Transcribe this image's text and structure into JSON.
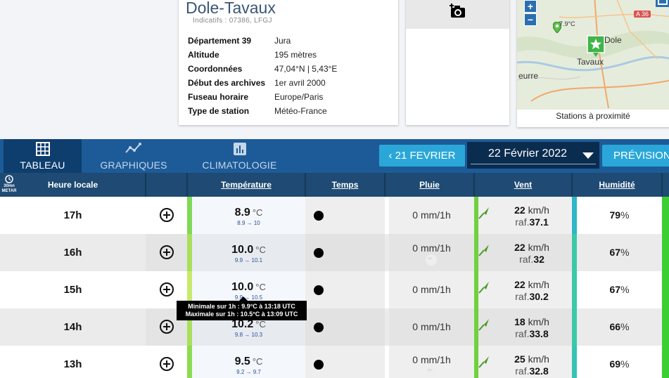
{
  "station": {
    "name": "Dole-Tavaux",
    "code": "Indicatifs : 07386, LFGJ",
    "info": [
      {
        "label": "Département 39",
        "value": "Jura"
      },
      {
        "label": "Altitude",
        "value": "195 mètres"
      },
      {
        "label": "Coordonnées",
        "value": "47,04°N | 5,43°E"
      },
      {
        "label": "Début des archives",
        "value": "1er avril 2000"
      },
      {
        "label": "Fuseau horaire",
        "value": "Europe/Paris"
      },
      {
        "label": "Type de station",
        "value": "Météo-France"
      }
    ]
  },
  "map": {
    "caption": "Stations à proximité",
    "zoom_in": "+",
    "zoom_out": "−",
    "labels": {
      "dole": "Dole",
      "tavaux": "Tavaux",
      "eurre": "eurre",
      "temp": "7.9°C",
      "road": "A 36"
    }
  },
  "nav": {
    "tabs": [
      {
        "label": "TABLEAU",
        "icon": "table-icon"
      },
      {
        "label": "GRAPHIQUES",
        "icon": "line-chart-icon"
      },
      {
        "label": "CLIMATOLOGIE",
        "icon": "bar-chart-icon"
      }
    ],
    "prev_label": "21 FEVRIER",
    "date": "22 Février 2022",
    "forecast_label": "PRÉVISIONS"
  },
  "table": {
    "metar_label": "30mn METAR",
    "headers": {
      "hour": "Heure locale",
      "temp": "Température",
      "sky": "Temps",
      "rain": "Pluie",
      "wind": "Vent",
      "humidity": "Humidité"
    },
    "rows": [
      {
        "hour": "17h",
        "temp": "8.9",
        "tunit": "°C",
        "tmm": "8.9 → 10",
        "rain": "0 mm/1h",
        "rain_icon": false,
        "wind": "22",
        "wunit": "km/h",
        "gust_lbl": "raf.",
        "gust": "37.1",
        "hum": "79",
        "hunit": "%"
      },
      {
        "hour": "16h",
        "temp": "10.0",
        "tunit": "°C",
        "tmm": "9.9 → 10.1",
        "rain": "0 mm/1h",
        "rain_icon": true,
        "wind": "22",
        "wunit": "km/h",
        "gust_lbl": "raf.",
        "gust": "32",
        "hum": "67",
        "hunit": "%"
      },
      {
        "hour": "15h",
        "temp": "10.0",
        "tunit": "°C",
        "tmm": "9.9 → 10.5",
        "rain": "0 mm/1h",
        "rain_icon": false,
        "wind": "22",
        "wunit": "km/h",
        "gust_lbl": "raf.",
        "gust": "30.2",
        "hum": "67",
        "hunit": "%"
      },
      {
        "hour": "14h",
        "temp": "10.2",
        "tunit": "°C",
        "tmm": "9.8 → 10.3",
        "rain": "0 mm/1h",
        "rain_icon": false,
        "wind": "18",
        "wunit": "km/h",
        "gust_lbl": "raf.",
        "gust": "33.8",
        "hum": "66",
        "hunit": "%"
      },
      {
        "hour": "13h",
        "temp": "9.5",
        "tunit": "°C",
        "tmm": "9.2 → 9.7",
        "rain": "0 mm/1h",
        "rain_icon": true,
        "wind": "25",
        "wunit": "km/h",
        "gust_lbl": "raf.",
        "gust": "32.8",
        "hum": "69",
        "hunit": "%"
      }
    ]
  },
  "tooltip": {
    "line1": "Minimale sur 1h : 9.9°C à 13:18 UTC",
    "line2": "Maximale sur 1h : 10.5°C à 13:09 UTC"
  },
  "colors": {
    "nav": "#1d5b98",
    "nav_active": "#0e3e6e",
    "header": "#1e4a73",
    "accent": "#2aa7d8",
    "temp_bar": [
      "#7ed957",
      "#a8e05a",
      "#c7ea6a",
      "#a8e05a",
      "#8bdc4f"
    ],
    "wind_bar": "#6fd13c",
    "hum_bar": [
      "#2fb6c9",
      "#3cc9a8",
      "#3cc9a8",
      "#3cc9a8",
      "#36c4b4"
    ]
  }
}
